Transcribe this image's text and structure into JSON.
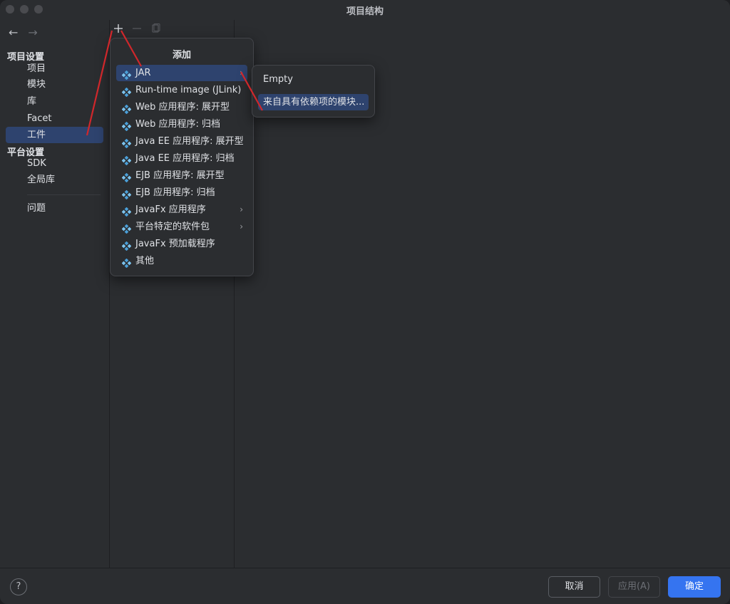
{
  "window": {
    "title": "项目结构"
  },
  "nav": {
    "back_icon": "arrow-left-icon",
    "forward_icon": "arrow-right-icon"
  },
  "sidebar": {
    "project_settings_header": "项目设置",
    "project_settings_items": [
      "项目",
      "模块",
      "库",
      "Facet",
      "工件"
    ],
    "platform_settings_header": "平台设置",
    "platform_settings_items": [
      "SDK",
      "全局库"
    ],
    "problems": "问题",
    "selected": "工件"
  },
  "toolbar": {
    "add_icon": "plus-icon",
    "remove_icon": "minus-icon",
    "copy_icon": "copy-icon"
  },
  "add_popup": {
    "title": "添加",
    "items": [
      {
        "label": "JAR",
        "submenu": true,
        "selected": true
      },
      {
        "label": "Run-time image (JLink)"
      },
      {
        "label": "Web 应用程序: 展开型"
      },
      {
        "label": "Web 应用程序: 归档"
      },
      {
        "label": "Java EE 应用程序: 展开型"
      },
      {
        "label": "Java EE 应用程序: 归档"
      },
      {
        "label": "EJB 应用程序: 展开型"
      },
      {
        "label": "EJB 应用程序: 归档"
      },
      {
        "label": "JavaFx 应用程序",
        "submenu": true
      },
      {
        "label": "平台特定的软件包",
        "submenu": true
      },
      {
        "label": "JavaFx 预加载程序"
      },
      {
        "label": "其他"
      }
    ]
  },
  "jar_submenu": {
    "items": [
      "Empty",
      "来自具有依赖项的模块..."
    ],
    "selected": "来自具有依赖项的模块..."
  },
  "footer": {
    "help": "?",
    "cancel": "取消",
    "apply": "应用(A)",
    "ok": "确定"
  },
  "colors": {
    "accent": "#3574f0",
    "selection": "#2e436e",
    "annotation": "#d0272b",
    "icon": "#4a9fd8"
  }
}
